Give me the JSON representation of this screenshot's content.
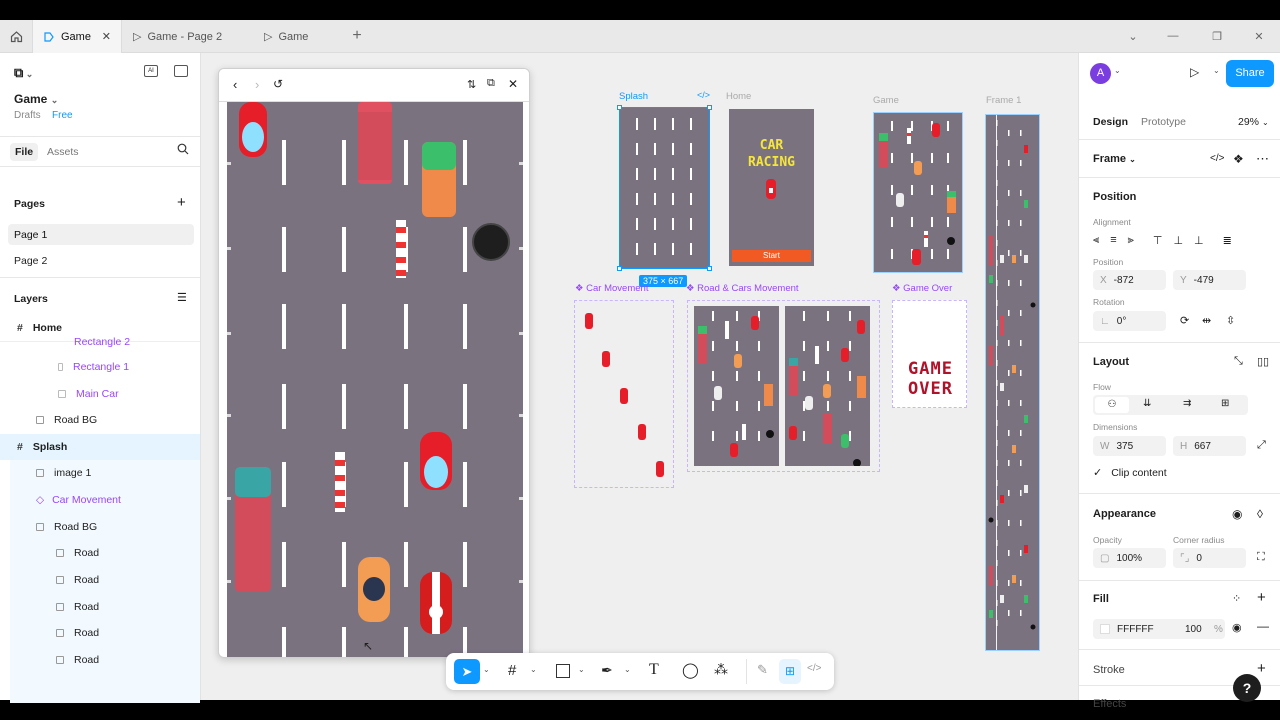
{
  "tabs": [
    {
      "label": "Game",
      "active": true
    },
    {
      "label": "Game - Page 2"
    },
    {
      "label": "Game"
    }
  ],
  "file": {
    "name": "Game",
    "location": "Drafts",
    "plan": "Free"
  },
  "left_tabs": {
    "file": "File",
    "assets": "Assets"
  },
  "pages": {
    "title": "Pages",
    "items": [
      "Page 1",
      "Page 2"
    ]
  },
  "layers": {
    "title": "Layers",
    "items": [
      {
        "label": "Home",
        "kind": "frame"
      },
      {
        "label": "Rectangle 2",
        "kind": "rect"
      },
      {
        "label": "Rectangle 1",
        "kind": "rect"
      },
      {
        "label": "Main Car",
        "kind": "rect"
      },
      {
        "label": "Road BG",
        "kind": "group"
      },
      {
        "label": "Splash",
        "kind": "frame"
      },
      {
        "label": "image 1",
        "kind": "image"
      },
      {
        "label": "Car Movement",
        "kind": "component"
      },
      {
        "label": "Road BG",
        "kind": "group"
      },
      {
        "label": "Road",
        "kind": "image"
      },
      {
        "label": "Road",
        "kind": "image"
      },
      {
        "label": "Road",
        "kind": "image"
      },
      {
        "label": "Road",
        "kind": "image"
      },
      {
        "label": "Road",
        "kind": "image"
      }
    ]
  },
  "canvas": {
    "frames": {
      "splash": "Splash",
      "home": "Home",
      "game": "Game",
      "frame1": "Frame 1"
    },
    "size_badge": "375 × 667",
    "car_movement": "Car Movement",
    "road_cars": "Road & Cars Movement",
    "game_over_label": "Game Over",
    "home_title": "CAR\nRACING",
    "home_start": "Start",
    "game_over_text": "GAME\nOVER"
  },
  "right_panel": {
    "avatar": "A",
    "share": "Share",
    "tabs": {
      "design": "Design",
      "prototype": "Prototype"
    },
    "zoom": "29%",
    "frame_title": "Frame",
    "position": {
      "title": "Position",
      "alignment": "Alignment",
      "position_label": "Position",
      "x_label": "X",
      "x": "-872",
      "y_label": "Y",
      "y": "-479",
      "rotation_label": "Rotation",
      "rotation": "0°"
    },
    "layout": {
      "title": "Layout",
      "flow": "Flow",
      "dimensions": "Dimensions",
      "w_label": "W",
      "w": "375",
      "h_label": "H",
      "h": "667",
      "clip": "Clip content"
    },
    "appearance": {
      "title": "Appearance",
      "opacity_label": "Opacity",
      "opacity": "100%",
      "radius_label": "Corner radius",
      "radius": "0"
    },
    "fill": {
      "title": "Fill",
      "hex": "FFFFFF",
      "opacity": "100",
      "unit": "%"
    },
    "stroke": "Stroke",
    "effects": "Effects",
    "help": "?"
  },
  "colors": {
    "accent": "#0d99ff",
    "component": "#9747ff",
    "road": "#7b7280",
    "share": "#0d99ff"
  }
}
